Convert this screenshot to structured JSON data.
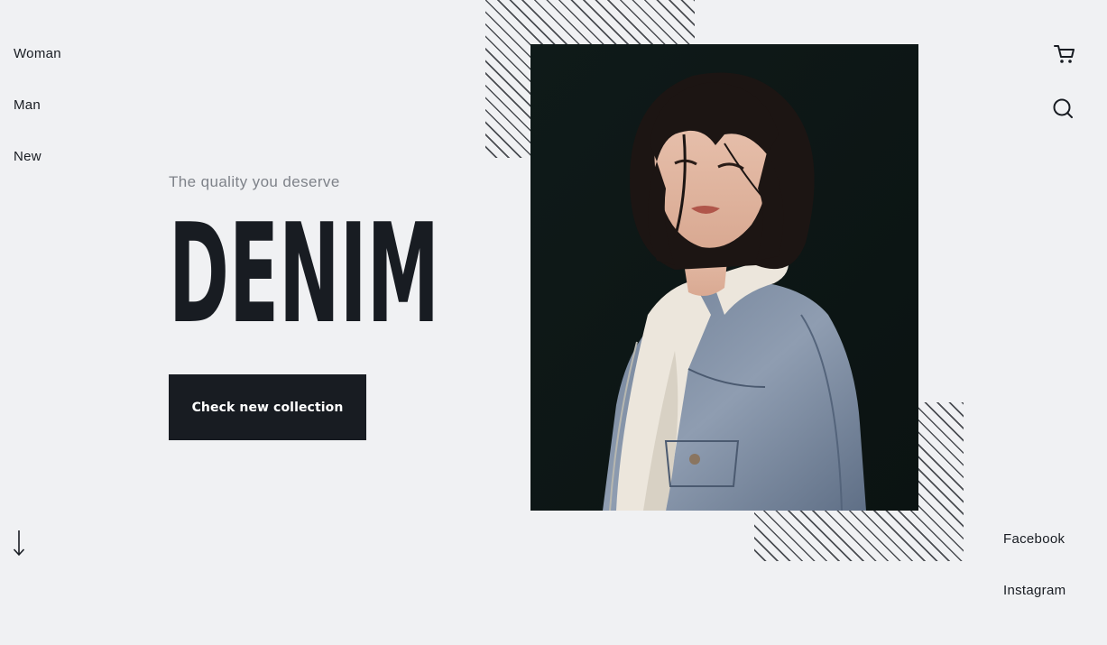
{
  "nav": {
    "items": [
      {
        "label": "Woman"
      },
      {
        "label": "Man"
      },
      {
        "label": "New"
      }
    ]
  },
  "hero": {
    "tagline": "The quality you deserve",
    "title": "DENIM",
    "cta_label": "Check new collection"
  },
  "header_icons": {
    "cart_icon": "cart-icon",
    "search_icon": "search-icon"
  },
  "social": {
    "items": [
      {
        "label": "Facebook"
      },
      {
        "label": "Instagram"
      }
    ]
  },
  "scroll": {
    "icon": "arrow-down-icon"
  },
  "colors": {
    "background": "#f0f1f3",
    "text_dark": "#181c22",
    "tagline": "#7e8289",
    "button_bg": "#181c22",
    "button_text": "#ffffff",
    "photo_bg": "#101817",
    "hatch": "#4a4d52"
  }
}
